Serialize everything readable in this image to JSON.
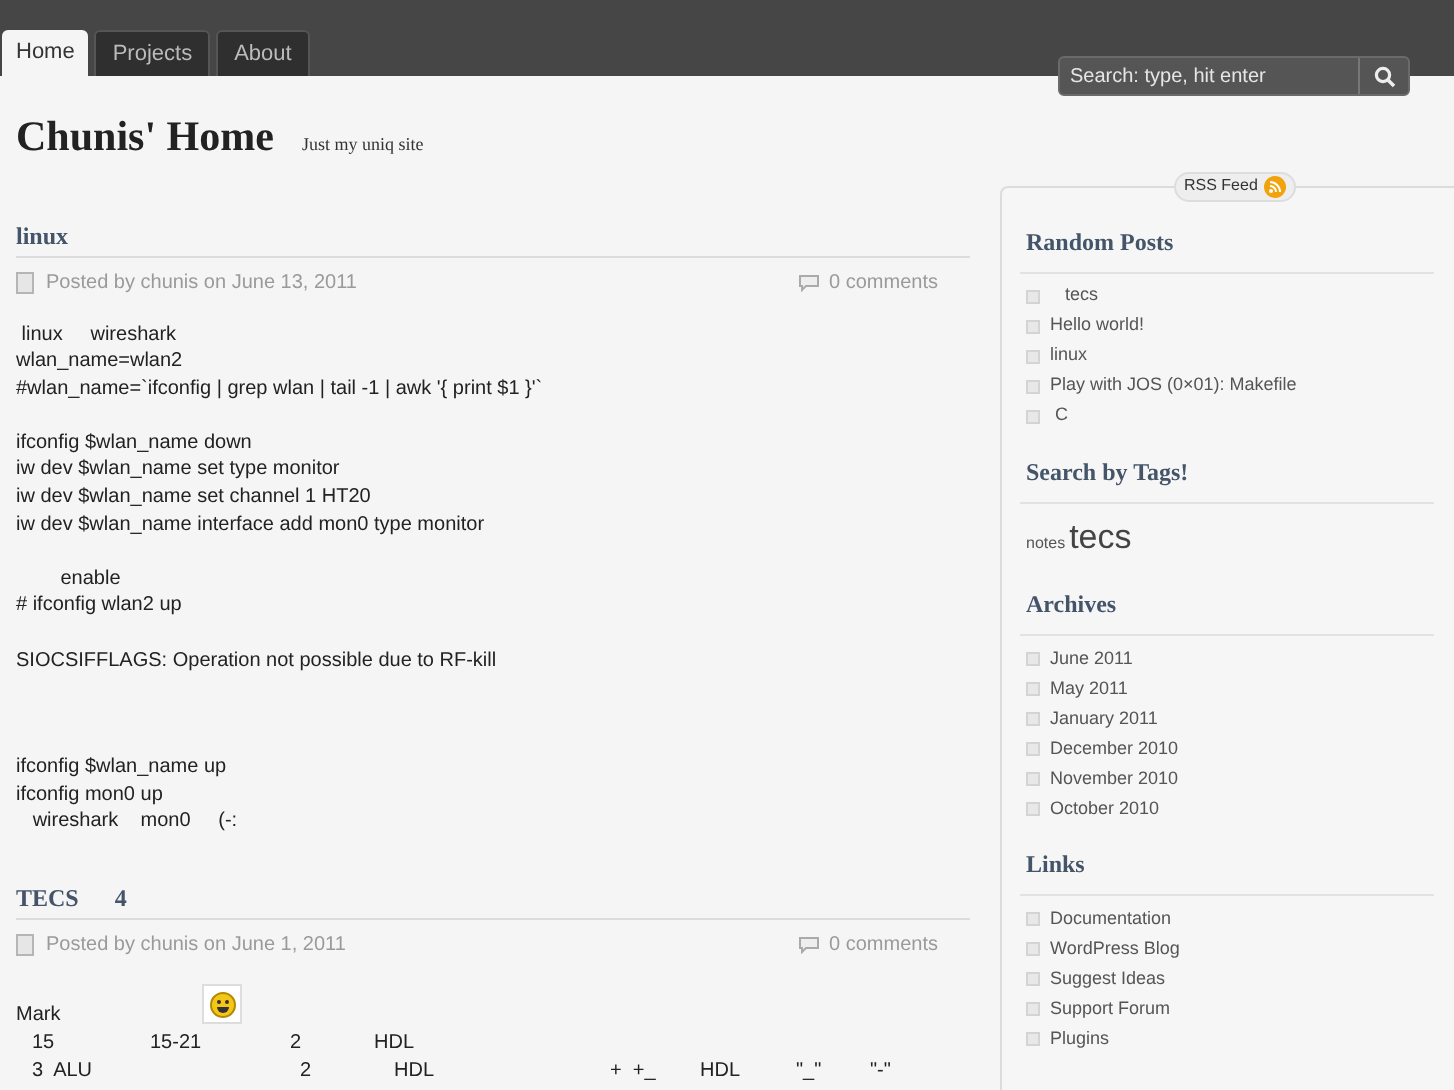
{
  "nav": {
    "tabs": [
      {
        "label": "Home",
        "selected": true
      },
      {
        "label": "Projects",
        "selected": false
      },
      {
        "label": "About",
        "selected": false
      }
    ]
  },
  "search": {
    "placeholder": "Search: type, hit enter"
  },
  "site": {
    "title": "Chunis' Home",
    "tagline": "Just my uniq site"
  },
  "posts": [
    {
      "title": "linux",
      "meta": "Posted by chunis on June 13, 2011",
      "comments": "0 comments",
      "paragraphs": [
        [
          " linux     wireshark",
          "wlan_name=wlan2",
          "#wlan_name=`ifconfig | grep wlan | tail -1 | awk '{ print $1 }'`"
        ],
        [
          "ifconfig $wlan_name down",
          "iw dev $wlan_name set type monitor",
          "iw dev $wlan_name set channel 1 HT20",
          "iw dev $wlan_name interface add mon0 type monitor"
        ],
        [
          "        enable",
          "# ifconfig wlan2 up"
        ],
        [
          "SIOCSIFFLAGS: Operation not possible due to RF-kill"
        ],
        [
          "ifconfig $wlan_name up",
          "ifconfig mon0 up",
          "   wireshark    mon0     (-:"
        ]
      ]
    },
    {
      "title": "TECS      4",
      "meta": "Posted by chunis on June 1, 2011",
      "comments": "0 comments",
      "intro": "Mark",
      "rows": [
        [
          "15",
          "15-21",
          "2",
          "HDL"
        ],
        [
          "3  ALU",
          "2",
          "HDL",
          "+  +_",
          "HDL",
          "\"_\"",
          "\"-\""
        ]
      ]
    }
  ],
  "sidebar": {
    "rss": "RSS Feed",
    "sections": [
      {
        "kind": "list",
        "title": "Random Posts",
        "items": [
          "   tecs",
          "Hello world!",
          "linux",
          "Play with JOS (0×01): Makefile",
          " C"
        ]
      },
      {
        "kind": "tags",
        "title": "Search by Tags!",
        "items": [
          {
            "label": "notes",
            "kind": "small"
          },
          {
            "label": "tecs",
            "kind": "large"
          }
        ]
      },
      {
        "kind": "list",
        "title": "Archives",
        "items": [
          "June 2011",
          "May 2011",
          "January 2011",
          "December 2010",
          "November 2010",
          "October 2010"
        ]
      },
      {
        "kind": "list",
        "title": "Links",
        "items": [
          "Documentation",
          "WordPress Blog",
          "Suggest Ideas",
          "Support Forum",
          "Plugins"
        ]
      }
    ]
  }
}
